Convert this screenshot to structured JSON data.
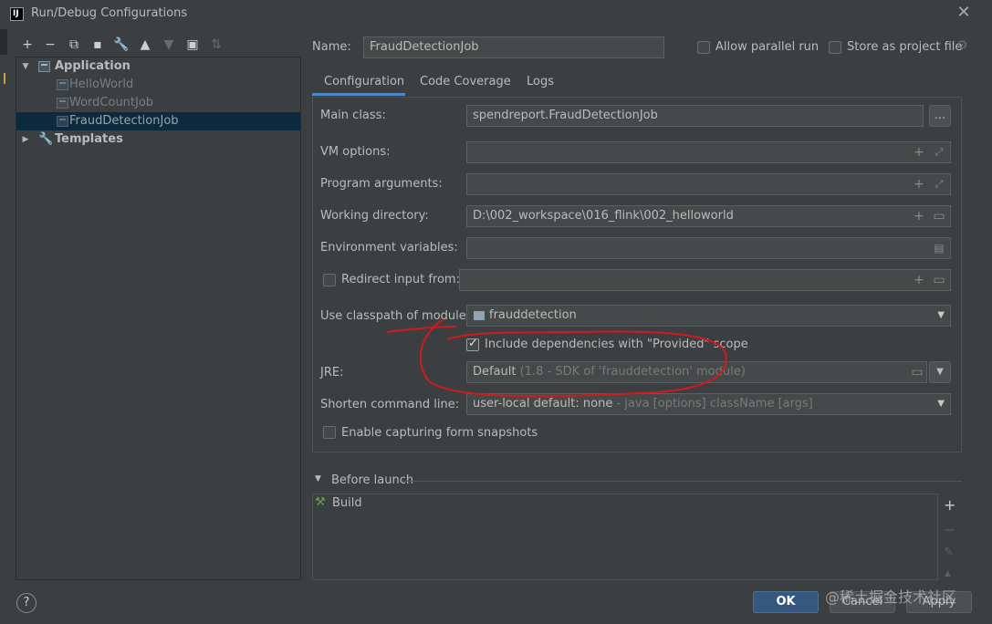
{
  "window": {
    "title": "Run/Debug Configurations",
    "app_icon": "IJ"
  },
  "toolbar": [
    "plus-icon",
    "minus-icon",
    "copy-icon",
    "save-icon",
    "wrench-icon",
    "arrow-up-icon",
    "arrow-down-icon",
    "folder-add-icon",
    "sort-icon"
  ],
  "tree": {
    "items": [
      {
        "label": "Application",
        "bold": true
      },
      {
        "label": "HelloWorld"
      },
      {
        "label": "WordCountJob"
      },
      {
        "label": "FraudDetectionJob",
        "selected": true
      },
      {
        "label": "Templates",
        "bold": true
      }
    ]
  },
  "header": {
    "name_label": "Name:",
    "name_value": "FraudDetectionJob",
    "allow_parallel": "Allow parallel run",
    "store_as_project": "Store as project file"
  },
  "tabs": [
    "Configuration",
    "Code Coverage",
    "Logs"
  ],
  "form": {
    "main_class_label": "Main class:",
    "main_class_value": "spendreport.FraudDetectionJob",
    "main_class_btn": "...",
    "vm_options_label": "VM options:",
    "program_args_label": "Program arguments:",
    "working_dir_label": "Working directory:",
    "working_dir_value": "D:\\002_workspace\\016_flink\\002_helloworld",
    "env_vars_label": "Environment variables:",
    "redirect_label": "Redirect input from:",
    "classpath_label": "Use classpath of module:",
    "classpath_value": "frauddetection",
    "include_deps_label": "Include dependencies with \"Provided\" scope",
    "jre_label": "JRE:",
    "jre_value": "Default",
    "jre_extra": "(1.8 - SDK of 'frauddetection' module)",
    "shorten_label": "Shorten command line:",
    "shorten_value": "user-local default: none",
    "shorten_extra": "- java [options] className [args]",
    "snapshots_label": "Enable capturing form snapshots"
  },
  "before_launch": {
    "title": "Before launch",
    "items": [
      "Build"
    ]
  },
  "buttons": {
    "ok": "OK",
    "cancel": "Cancel",
    "apply": "Apply",
    "help": "?"
  },
  "watermark": "@稀土掘金技术社区",
  "colors": {
    "accent": "#4a88c7",
    "selection": "#0d293e",
    "annotation": "#d11a1a"
  }
}
